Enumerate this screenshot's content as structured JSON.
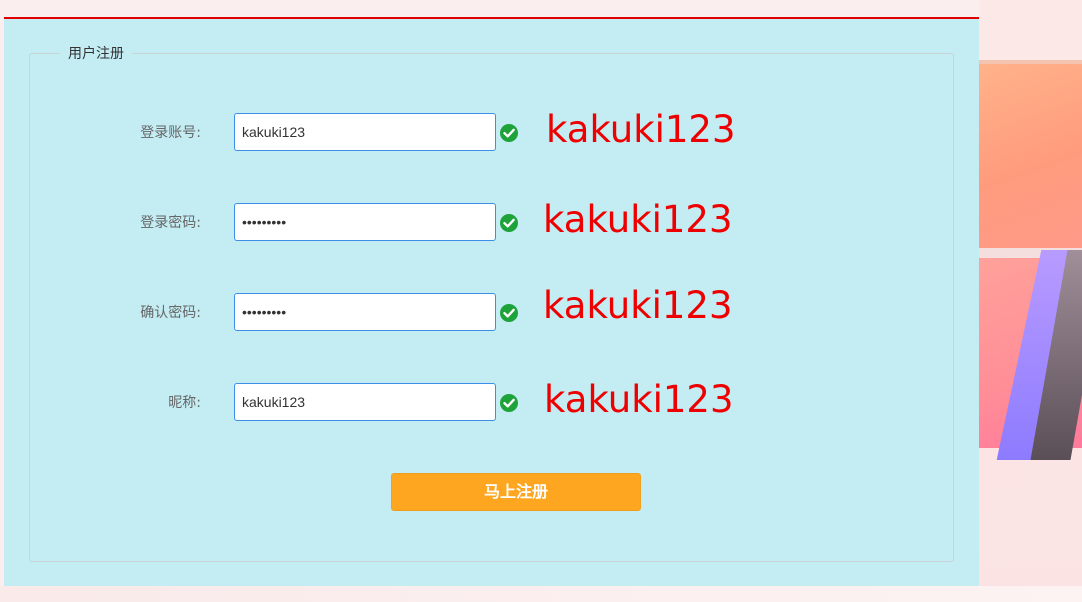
{
  "form": {
    "legend": "用户注册",
    "fields": [
      {
        "label": "登录账号:",
        "value": "kakuki123",
        "note": "kakuki123"
      },
      {
        "label": "登录密码:",
        "value": "•••••••••",
        "note": "kakuki123"
      },
      {
        "label": "确认密码:",
        "value": "•••••••••",
        "note": "kakuki123"
      },
      {
        "label": "昵称:",
        "value": "kakuki123",
        "note": "kakuki123"
      }
    ],
    "submit_label": "马上注册"
  },
  "colors": {
    "accent_line": "#e00000",
    "panel_bg": "#c3ecf3",
    "input_border": "#3d8fe8",
    "valid_check": "#1ea33a",
    "annotation_text": "#ef0000",
    "submit_bg": "#ffa620"
  },
  "icons": {
    "valid": "check-circle-icon"
  }
}
